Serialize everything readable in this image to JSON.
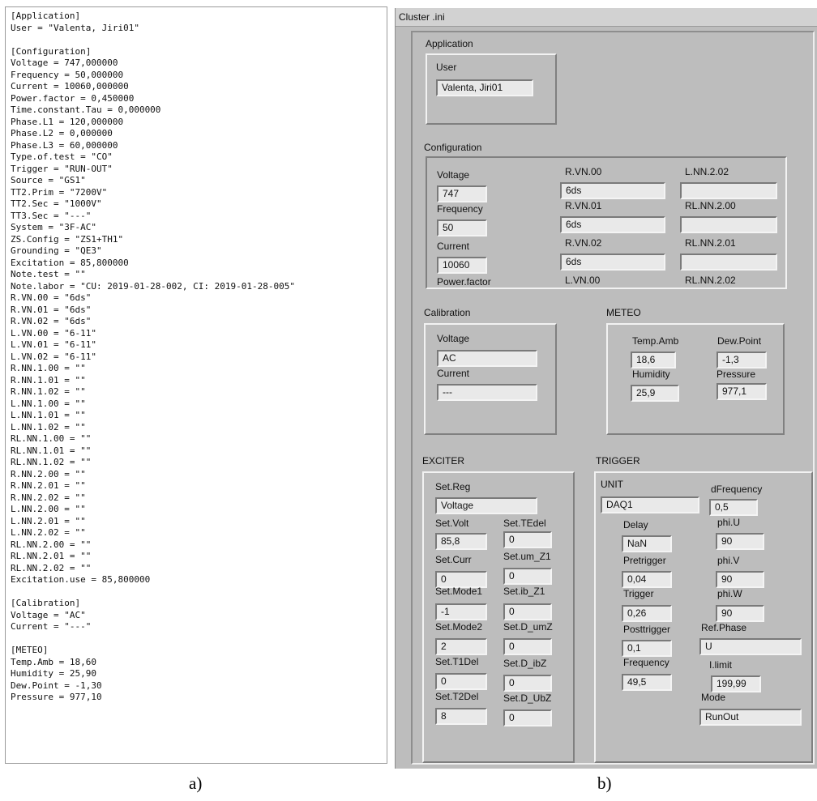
{
  "ini_file": {
    "lines": [
      "[Application]",
      "User = \"Valenta, Jiri01\"",
      "",
      "[Configuration]",
      "Voltage = 747,000000",
      "Frequency = 50,000000",
      "Current = 10060,000000",
      "Power.factor = 0,450000",
      "Time.constant.Tau = 0,000000",
      "Phase.L1 = 120,000000",
      "Phase.L2 = 0,000000",
      "Phase.L3 = 60,000000",
      "Type.of.test = \"CO\"",
      "Trigger = \"RUN-OUT\"",
      "Source = \"GS1\"",
      "TT2.Prim = \"7200V\"",
      "TT2.Sec = \"1000V\"",
      "TT3.Sec = \"---\"",
      "System = \"3F-AC\"",
      "ZS.Config = \"ZS1+TH1\"",
      "Grounding = \"QE3\"",
      "Excitation = 85,800000",
      "Note.test = \"\"",
      "Note.labor = \"CU: 2019-01-28-002, CI: 2019-01-28-005\"",
      "R.VN.00 = \"6ds\"",
      "R.VN.01 = \"6ds\"",
      "R.VN.02 = \"6ds\"",
      "L.VN.00 = \"6-11\"",
      "L.VN.01 = \"6-11\"",
      "L.VN.02 = \"6-11\"",
      "R.NN.1.00 = \"\"",
      "R.NN.1.01 = \"\"",
      "R.NN.1.02 = \"\"",
      "L.NN.1.00 = \"\"",
      "L.NN.1.01 = \"\"",
      "L.NN.1.02 = \"\"",
      "RL.NN.1.00 = \"\"",
      "RL.NN.1.01 = \"\"",
      "RL.NN.1.02 = \"\"",
      "R.NN.2.00 = \"\"",
      "R.NN.2.01 = \"\"",
      "R.NN.2.02 = \"\"",
      "L.NN.2.00 = \"\"",
      "L.NN.2.01 = \"\"",
      "L.NN.2.02 = \"\"",
      "RL.NN.2.00 = \"\"",
      "RL.NN.2.01 = \"\"",
      "RL.NN.2.02 = \"\"",
      "Excitation.use = 85,800000",
      "",
      "[Calibration]",
      "Voltage = \"AC\"",
      "Current = \"---\"",
      "",
      "[METEO]",
      "Temp.Amb = 18,60",
      "Humidity = 25,90",
      "Dew.Point = -1,30",
      "Pressure = 977,10"
    ]
  },
  "captions": {
    "a": "a)",
    "b": "b)"
  },
  "window": {
    "title": "Cluster .ini"
  },
  "application": {
    "title": "Application",
    "user_label": "User",
    "user_value": "Valenta, Jiri01"
  },
  "configuration": {
    "title": "Configuration",
    "voltage_label": "Voltage",
    "voltage_value": "747",
    "frequency_label": "Frequency",
    "frequency_value": "50",
    "current_label": "Current",
    "current_value": "10060",
    "power_factor_label": "Power.factor",
    "rvn00_label": "R.VN.00",
    "rvn00_value": "6ds",
    "rvn01_label": "R.VN.01",
    "rvn01_value": "6ds",
    "rvn02_label": "R.VN.02",
    "rvn02_value": "6ds",
    "lvn00_label": "L.VN.00",
    "lnn202_label": "L.NN.2.02",
    "lnn202_value": "",
    "rlnn200_label": "RL.NN.2.00",
    "rlnn200_value": "",
    "rlnn201_label": "RL.NN.2.01",
    "rlnn201_value": "",
    "rlnn202_label": "RL.NN.2.02"
  },
  "calibration": {
    "title": "Calibration",
    "voltage_label": "Voltage",
    "voltage_value": "AC",
    "current_label": "Current",
    "current_value": "---"
  },
  "meteo": {
    "title": "METEO",
    "temp_label": "Temp.Amb",
    "temp_value": "18,6",
    "dew_label": "Dew.Point",
    "dew_value": "-1,3",
    "humidity_label": "Humidity",
    "humidity_value": "25,9",
    "pressure_label": "Pressure",
    "pressure_value": "977,1"
  },
  "exciter": {
    "title": "EXCITER",
    "setreg_label": "Set.Reg",
    "setreg_value": "Voltage",
    "setvolt_label": "Set.Volt",
    "setvolt_value": "85,8",
    "settedel_label": "Set.TEdel",
    "settedel_value": "0",
    "setcurr_label": "Set.Curr",
    "setcurr_value": "0",
    "setumz1_label": "Set.um_Z1",
    "setumz1_value": "0",
    "setmode1_label": "Set.Mode1",
    "setmode1_value": "-1",
    "setibz1_label": "Set.ib_Z1",
    "setibz1_value": "0",
    "setmode2_label": "Set.Mode2",
    "setmode2_value": "2",
    "setdumz_label": "Set.D_umZ",
    "setdumz_value": "0",
    "sett1del_label": "Set.T1Del",
    "sett1del_value": "0",
    "setdibz_label": "Set.D_ibZ",
    "setdibz_value": "0",
    "sett2del_label": "Set.T2Del",
    "sett2del_value": "8",
    "setdubz_label": "Set.D_UbZ",
    "setdubz_value": "0"
  },
  "trigger": {
    "title": "TRIGGER",
    "unit_label": "UNIT",
    "unit_value": "DAQ1",
    "delay_label": "Delay",
    "delay_value": "NaN",
    "pretrigger_label": "Pretrigger",
    "pretrigger_value": "0,04",
    "trigger_label": "Trigger",
    "trigger_value": "0,26",
    "posttrigger_label": "Posttrigger",
    "posttrigger_value": "0,1",
    "frequency_label": "Frequency",
    "frequency_value": "49,5",
    "dfreq_label": "dFrequency",
    "dfreq_value": "0,5",
    "phiu_label": "phi.U",
    "phiu_value": "90",
    "phiv_label": "phi.V",
    "phiv_value": "90",
    "phiw_label": "phi.W",
    "phiw_value": "90",
    "refphase_label": "Ref.Phase",
    "refphase_value": "U",
    "ilimit_label": "I.limit",
    "ilimit_value": "199,99",
    "mode_label": "Mode",
    "mode_value": "RunOut"
  }
}
